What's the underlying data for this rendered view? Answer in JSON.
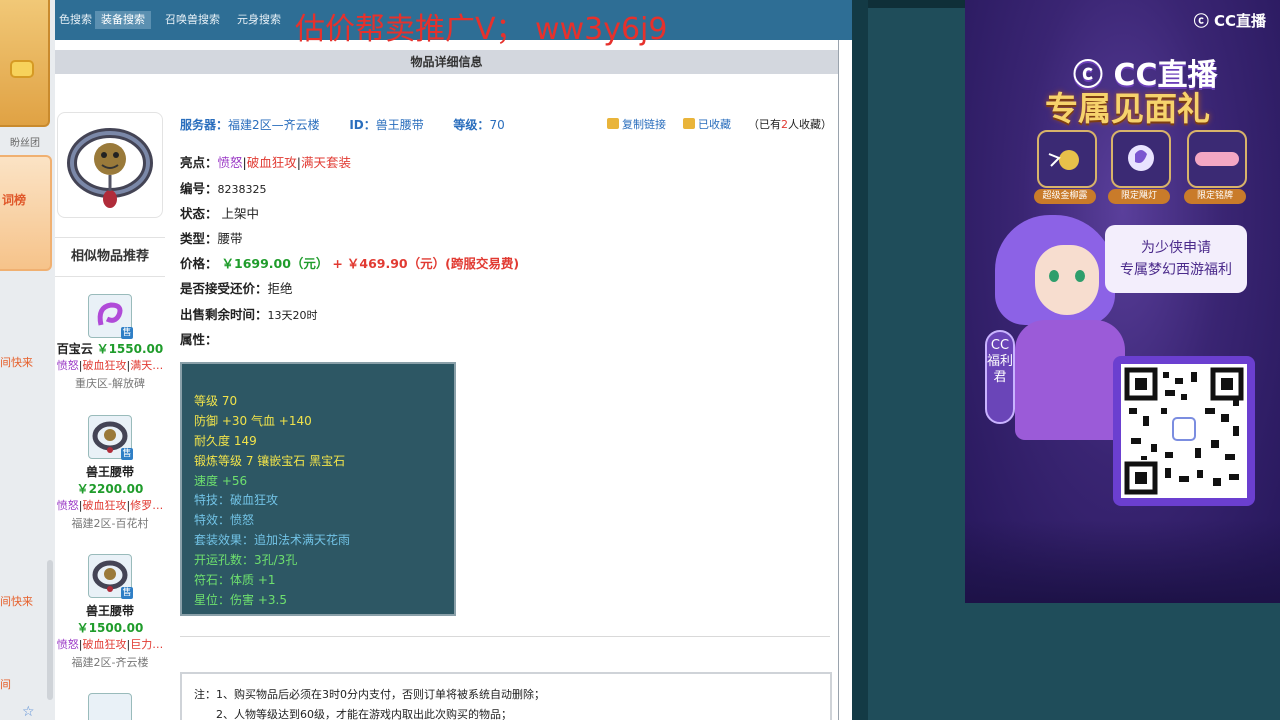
{
  "left_strip": {
    "label": "盼丝团",
    "tile_text": "词榜",
    "fast_items": [
      "间快来",
      "间快来",
      "间"
    ]
  },
  "nav": {
    "tabs": [
      "色搜索",
      "装备搜索",
      "召唤兽搜索",
      "元身搜索"
    ],
    "active_index": 1
  },
  "watermark": "估价帮卖推广V；  ww3y6j9",
  "detail_header": "物品详细信息",
  "info": {
    "server_label": "服务器：",
    "server_value": "福建2区—齐云楼",
    "id_label": "ID：",
    "id_value": "兽王腰带",
    "level_label": "等级：",
    "level_value": "70",
    "copy_link": "复制链接",
    "favorited": "已收藏",
    "fav_count_pre": "（已有",
    "fav_count": "2",
    "fav_count_post": "人收藏）"
  },
  "details": {
    "highlight_label": "亮点：",
    "highlights": [
      "愤怒",
      "破血狂攻",
      "满天套装"
    ],
    "serial_label": "编号：",
    "serial_value": "8238325",
    "status_label": "状态：",
    "status_value": "上架中",
    "type_label": "类型：",
    "type_value": "腰带",
    "price_label": "价格：",
    "price_value": "￥1699.00（元）",
    "price_plus": "+",
    "fee_value": "￥469.90（元）(跨服交易费)",
    "bargain_label": "是否接受还价：",
    "bargain_value": "拒绝",
    "remain_label": "出售剩余时间：",
    "remain_value": "13天20时",
    "attr_label": "属性："
  },
  "attributes": {
    "lines": [
      {
        "text": "等级 70",
        "color": "yellow"
      },
      {
        "text": "防御 +30 气血 +140",
        "color": "yellow"
      },
      {
        "text": "耐久度 149",
        "color": "yellow"
      },
      {
        "text": "锻炼等级 7 镶嵌宝石 黑宝石",
        "color": "yellow"
      },
      {
        "text": "速度 +56",
        "color": "green"
      },
      {
        "text": "特技：破血狂攻",
        "color": "blue"
      },
      {
        "text": "特效：愤怒",
        "color": "blue"
      },
      {
        "text": "套装效果：追加法术满天花雨",
        "color": "blue"
      },
      {
        "text": "开运孔数：3孔/3孔",
        "color": "green"
      },
      {
        "text": "符石：体质 +1",
        "color": "green"
      },
      {
        "text": "星位：伤害 +3.5",
        "color": "green"
      }
    ]
  },
  "similar": {
    "header": "相似物品推荐",
    "sell_badge": "售",
    "items": [
      {
        "name": "百宝云",
        "price": "￥1550.00",
        "tag1": "愤怒",
        "tag2": "破血狂攻",
        "tag3": "满天…",
        "location": "重庆区-解放碑"
      },
      {
        "name": "兽王腰带",
        "price": "￥2200.00",
        "tag1": "愤怒",
        "tag2": "破血狂攻",
        "tag3": "修罗…",
        "location": "福建2区-百花村"
      },
      {
        "name": "兽王腰带",
        "price": "￥1500.00",
        "tag1": "愤怒",
        "tag2": "破血狂攻",
        "tag3": "巨力…",
        "location": "福建2区-齐云楼"
      }
    ]
  },
  "notes": [
    "注：1、购买物品后必须在3时0分内支付，否则订单将被系统自动删除；",
    "2、人物等级达到60级，才能在游戏内取出此次购买的物品；"
  ],
  "ad": {
    "brand_small": "CC直播",
    "brand_big": "CC直播",
    "headline": "专属见面礼",
    "gifts": [
      "超级金柳露",
      "限定飓灯",
      "限定铭牌"
    ],
    "bubble_line1": "为少侠申请",
    "bubble_line2": "专属梦幻西游福利",
    "vertical_tag": "CC福利君",
    "accent_gold": "#f7d36c",
    "panel_purple": "#3a2573"
  }
}
